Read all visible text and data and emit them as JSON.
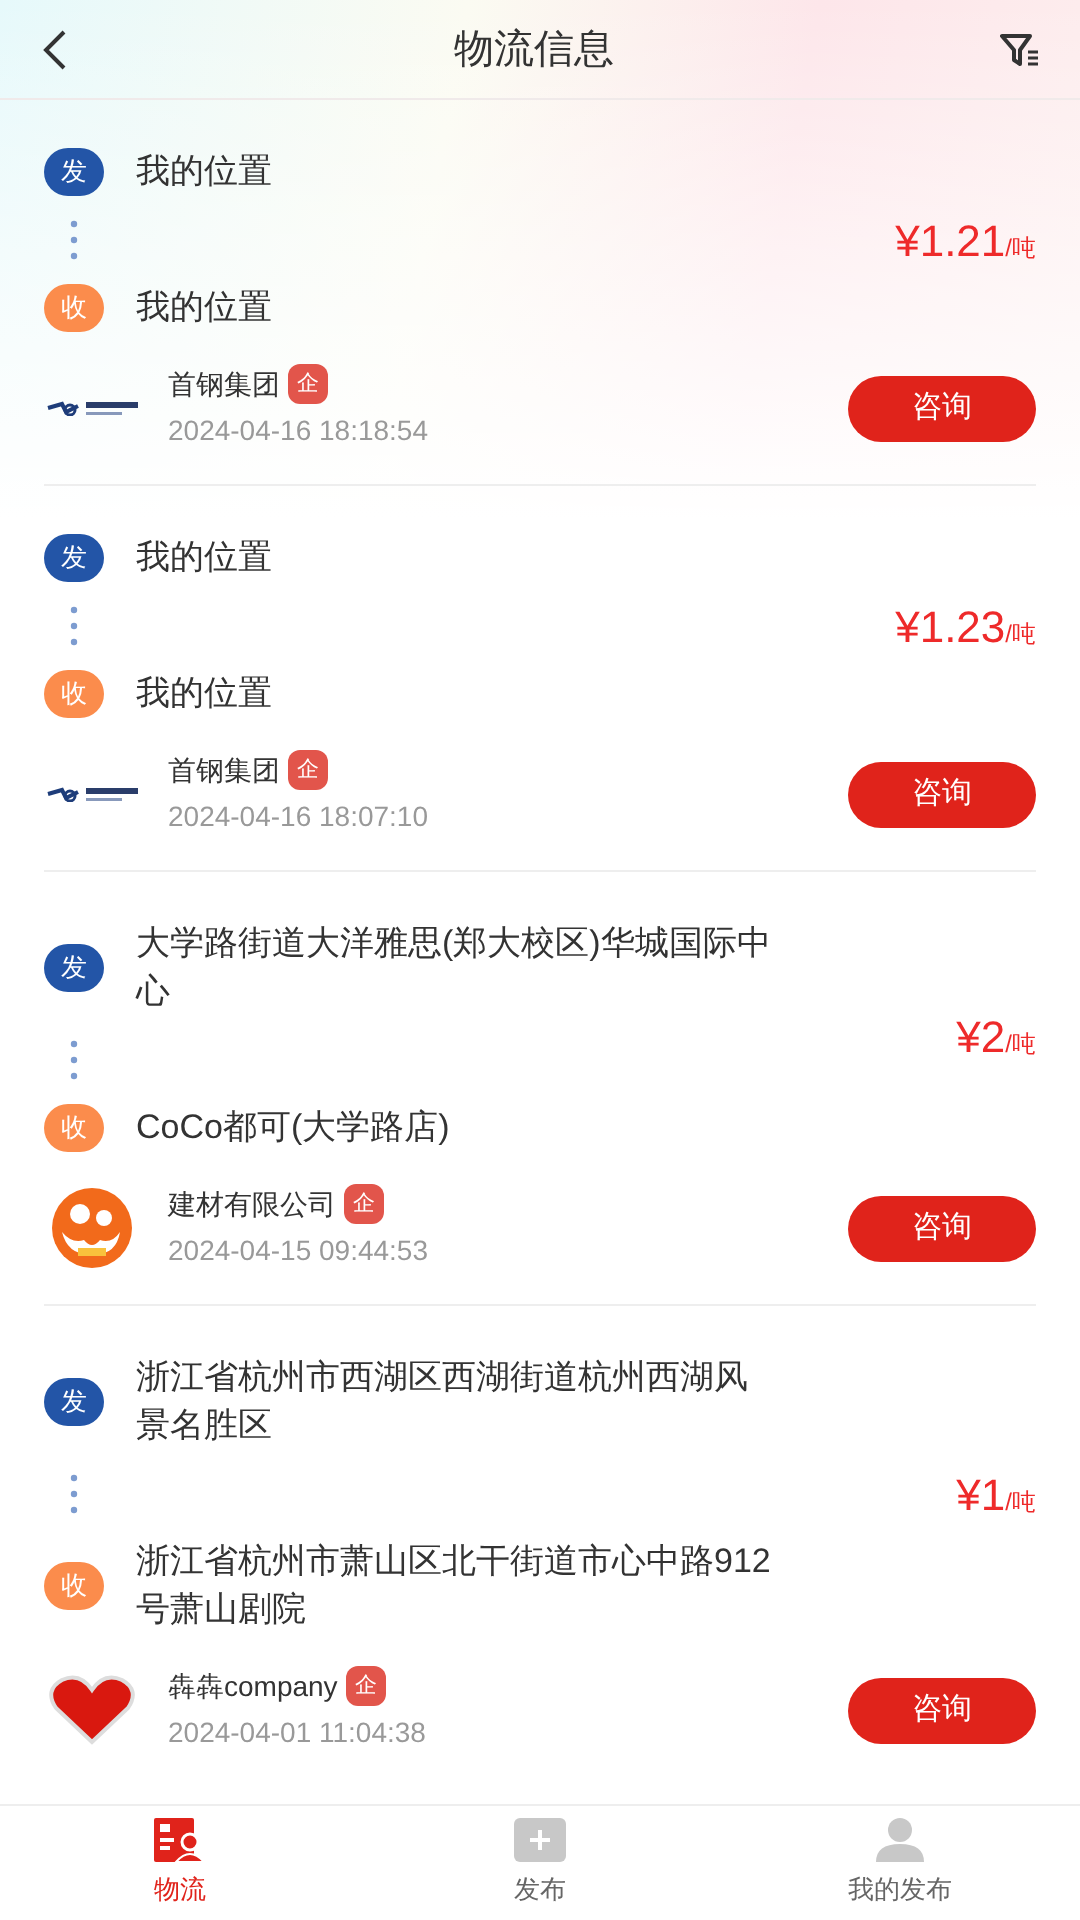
{
  "header": {
    "title": "物流信息"
  },
  "listings": [
    {
      "origin": {
        "tag": "发",
        "address": "我的位置"
      },
      "destination": {
        "tag": "收",
        "address": "我的位置"
      },
      "price": {
        "amount": "¥1.21",
        "unit": "/吨"
      },
      "company": {
        "name": "首钢集团",
        "badge": "企",
        "time": "2024-04-16 18:18:54"
      },
      "action": "咨询"
    },
    {
      "origin": {
        "tag": "发",
        "address": "我的位置"
      },
      "destination": {
        "tag": "收",
        "address": "我的位置"
      },
      "price": {
        "amount": "¥1.23",
        "unit": "/吨"
      },
      "company": {
        "name": "首钢集团",
        "badge": "企",
        "time": "2024-04-16 18:07:10"
      },
      "action": "咨询"
    },
    {
      "origin": {
        "tag": "发",
        "address": "大学路街道大洋雅思(郑大校区)华城国际中心"
      },
      "destination": {
        "tag": "收",
        "address": "CoCo都可(大学路店)"
      },
      "price": {
        "amount": "¥2",
        "unit": "/吨"
      },
      "company": {
        "name": "建材有限公司",
        "badge": "企",
        "time": "2024-04-15 09:44:53"
      },
      "action": "咨询"
    },
    {
      "origin": {
        "tag": "发",
        "address": "浙江省杭州市西湖区西湖街道杭州西湖风景名胜区"
      },
      "destination": {
        "tag": "收",
        "address": "浙江省杭州市萧山区北干街道市心中路912号萧山剧院"
      },
      "price": {
        "amount": "¥1",
        "unit": "/吨"
      },
      "company": {
        "name": "犇犇company",
        "badge": "企",
        "time": "2024-04-01 11:04:38"
      },
      "action": "咨询"
    }
  ],
  "tab_bar": [
    {
      "label": "物流",
      "selected": true
    },
    {
      "label": "发布",
      "selected": false
    },
    {
      "label": "我的发布",
      "selected": false
    }
  ]
}
